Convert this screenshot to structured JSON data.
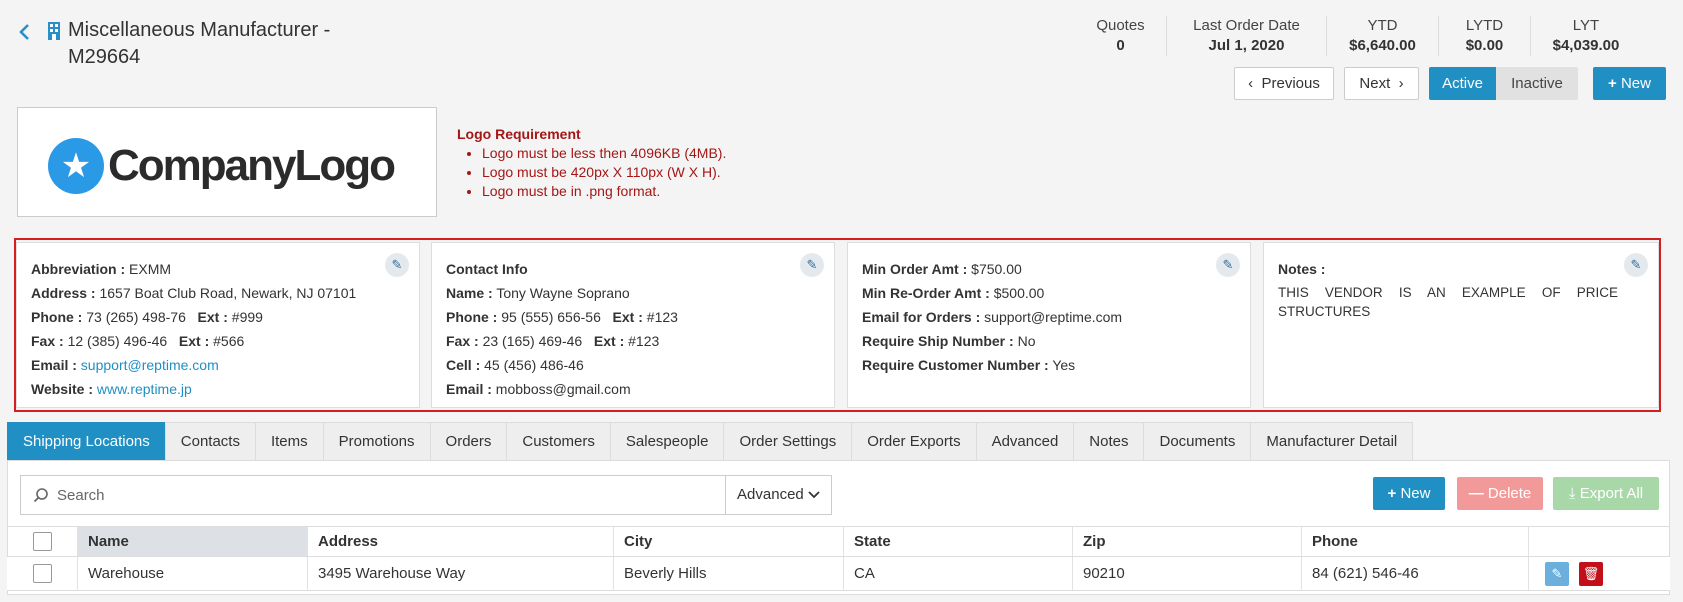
{
  "header": {
    "title": "Miscellaneous Manufacturer - M29664",
    "stats": [
      {
        "label": "Quotes",
        "value": "0"
      },
      {
        "label": "Last Order Date",
        "value": "Jul 1, 2020"
      },
      {
        "label": "YTD",
        "value": "$6,640.00"
      },
      {
        "label": "LYTD",
        "value": "$0.00"
      },
      {
        "label": "LYT",
        "value": "$4,039.00"
      }
    ],
    "previous_label": "Previous",
    "next_label": "Next",
    "active_label": "Active",
    "inactive_label": "Inactive",
    "new_label": "New"
  },
  "logo": {
    "text": "CompanyLogo",
    "requirement_title": "Logo Requirement",
    "requirements": [
      "Logo must be less then 4096KB (4MB).",
      "Logo must be 420px X 110px (W X H).",
      "Logo must be in .png format."
    ]
  },
  "vendor": {
    "abbreviation_label": "Abbreviation :",
    "abbreviation": "EXMM",
    "address_label": "Address :",
    "address": "1657 Boat Club Road, Newark, NJ 07101",
    "phone_label": "Phone :",
    "phone": "73 (265) 498-76",
    "phone_ext_label": "Ext :",
    "phone_ext": "#999",
    "fax_label": "Fax :",
    "fax": "12 (385) 496-46",
    "fax_ext_label": "Ext :",
    "fax_ext": "#566",
    "email_label": "Email :",
    "email": "support@reptime.com",
    "website_label": "Website :",
    "website": "www.reptime.jp"
  },
  "contact": {
    "title": "Contact Info",
    "name_label": "Name :",
    "name": "Tony Wayne Soprano",
    "phone_label": "Phone :",
    "phone": "95 (555) 656-56",
    "phone_ext_label": "Ext :",
    "phone_ext": "#123",
    "fax_label": "Fax :",
    "fax": "23 (165) 469-46",
    "fax_ext_label": "Ext :",
    "fax_ext": "#123",
    "cell_label": "Cell :",
    "cell": "45 (456) 486-46",
    "email_label": "Email :",
    "email": "mobboss@gmail.com"
  },
  "orders": {
    "min_order_label": "Min Order Amt :",
    "min_order": "$750.00",
    "min_reorder_label": "Min Re-Order Amt :",
    "min_reorder": "$500.00",
    "email_orders_label": "Email for Orders :",
    "email_orders": "support@reptime.com",
    "require_ship_label": "Require Ship Number :",
    "require_ship": "No",
    "require_customer_label": "Require Customer Number :",
    "require_customer": "Yes"
  },
  "notes": {
    "label": "Notes :",
    "text": "THIS VENDOR IS AN EXAMPLE OF PRICE STRUCTURES"
  },
  "tabs": [
    "Shipping Locations",
    "Contacts",
    "Items",
    "Promotions",
    "Orders",
    "Customers",
    "Salespeople",
    "Order Settings",
    "Order Exports",
    "Advanced",
    "Notes",
    "Documents",
    "Manufacturer Detail"
  ],
  "toolbar": {
    "search_placeholder": "Search",
    "advanced_label": "Advanced",
    "new_label": "New",
    "delete_label": "Delete",
    "export_label": "Export All"
  },
  "table": {
    "columns": [
      "Name",
      "Address",
      "City",
      "State",
      "Zip",
      "Phone"
    ],
    "rows": [
      [
        "Warehouse",
        "3495 Warehouse Way",
        "Beverly Hills",
        "CA",
        "90210",
        "84 (621) 546-46"
      ]
    ]
  },
  "colors": {
    "accent": "#1f8fc4",
    "highlight_border": "#d21f1f",
    "requirement_text": "#a51616"
  }
}
